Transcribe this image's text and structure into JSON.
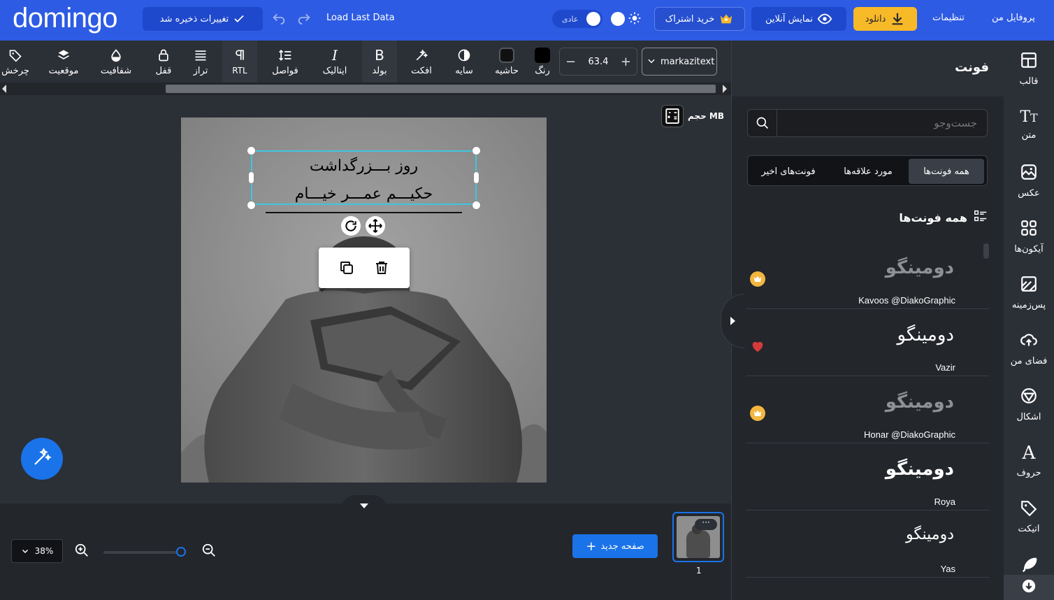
{
  "topbar": {
    "logo": "domingo",
    "save_status": "تغییرات ذخیره شد",
    "load_last": "Load Last Data",
    "mode_label": "عادی",
    "subscribe": "خرید اشتراک",
    "online_view": "نمایش آنلاین",
    "download": "دانلود",
    "settings": "تنظیمات",
    "profile": "پروفایل من"
  },
  "toolbar": {
    "font_name": "markazitext",
    "font_size": "63.4",
    "tools": {
      "color": "رنگ",
      "border": "حاشیه",
      "shadow": "سایه",
      "effect": "افکت",
      "bold": "بولد",
      "italic": "ایتالیک",
      "spacing": "فواصل",
      "rtl": "RTL",
      "align": "تراز",
      "lock": "قفل",
      "opacity": "شفافیت",
      "position": "موقعیت",
      "rotate": "چرخش"
    }
  },
  "canvas": {
    "size_label": "حجم MB",
    "text_line1": "روز بـــزرگداشت",
    "text_line2": "حکیـــم عمـــر خیـــام"
  },
  "bottom": {
    "zoom": "38%",
    "new_page": "صفحه جدید",
    "page_number": "1"
  },
  "panel": {
    "title": "فونت",
    "search_placeholder": "جست‌وجو",
    "tabs": [
      "همه فونت‌ها",
      "مورد علاقه‌ها",
      "فونت‌های اخیر"
    ],
    "section_title": "همه فونت‌ها",
    "fonts": [
      {
        "sample": "دومینگو",
        "name": "Kavoos @DiakoGraphic",
        "badge": "crown"
      },
      {
        "sample": "دومینگو",
        "name": "Vazir",
        "badge": "heart"
      },
      {
        "sample": "دومینگو",
        "name": "Honar @DiakoGraphic",
        "badge": "crown"
      },
      {
        "sample": "دومینگو",
        "name": "Roya",
        "badge": ""
      },
      {
        "sample": "دومینگو",
        "name": "Yas",
        "badge": ""
      }
    ]
  },
  "sidebar": {
    "items": [
      "قالب",
      "متن",
      "عکس",
      "آیکون‌ها",
      "پس‌زمینه",
      "فضای من",
      "اشکال",
      "حروف",
      "اتیکت"
    ]
  },
  "colors": {
    "brand": "#2d5be3",
    "accent_download": "#f7b928",
    "selection": "#3ec6e0",
    "primary_button": "#1a73e8"
  }
}
